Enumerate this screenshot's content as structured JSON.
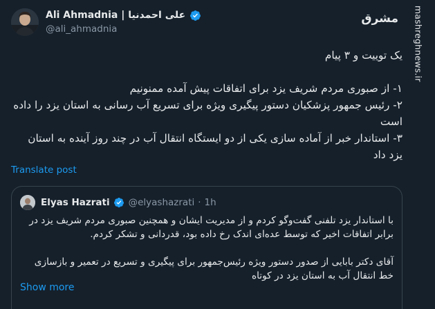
{
  "post": {
    "author_name": "Ali Ahmadnia | علی احمدنیا",
    "handle": "@ali_ahmadnia",
    "lines": [
      "یک توییت و ۳ پیام",
      "۱- از صبوری مردم شریف یزد برای اتفاقات پیش آمده ممنونیم",
      "۲- رئیس جمهور پزشکیان دستور پیگیری ویژه برای تسریع آب رسانی به استان یزد را داده است",
      "۳- استاندار خبر از آماده سازی یکی از دو ایستگاه انتقال آب در چند روز آینده به استان یزد داد"
    ],
    "translate_label": "Translate post"
  },
  "quote": {
    "author_name": "Elyas Hazrati",
    "handle": "@elyashazrati",
    "separator": "·",
    "time": "1h",
    "paragraph1": "با استاندار یزد تلفنی گفت‌وگو کردم و از مدیریت ایشان و همچنین صبوری مردم شریف یزد در برابر اتفاقات اخیر که توسط عده‌ای اندک رخ داده بود، قدردانی و تشکر کردم.",
    "paragraph2": "آقای دکتر بابایی از صدور دستور ویژه رئیس‌جمهور برای پیگیری و تسریع در تعمیر و بازسازی خط انتقال آب به استان یزد در کوتاه",
    "show_more_label": "Show more"
  },
  "watermark": {
    "logo_text": "مشرق",
    "site": "mashreghnews.ir"
  },
  "colors": {
    "background": "#15202b",
    "text": "#e7e9ea",
    "muted": "#8b98a5",
    "link": "#1d9bf0",
    "verified": "#1d9bf0",
    "border": "#38444d"
  },
  "icons": {
    "verified": "verified-badge-icon",
    "logo": "mashregh-logo-icon"
  }
}
